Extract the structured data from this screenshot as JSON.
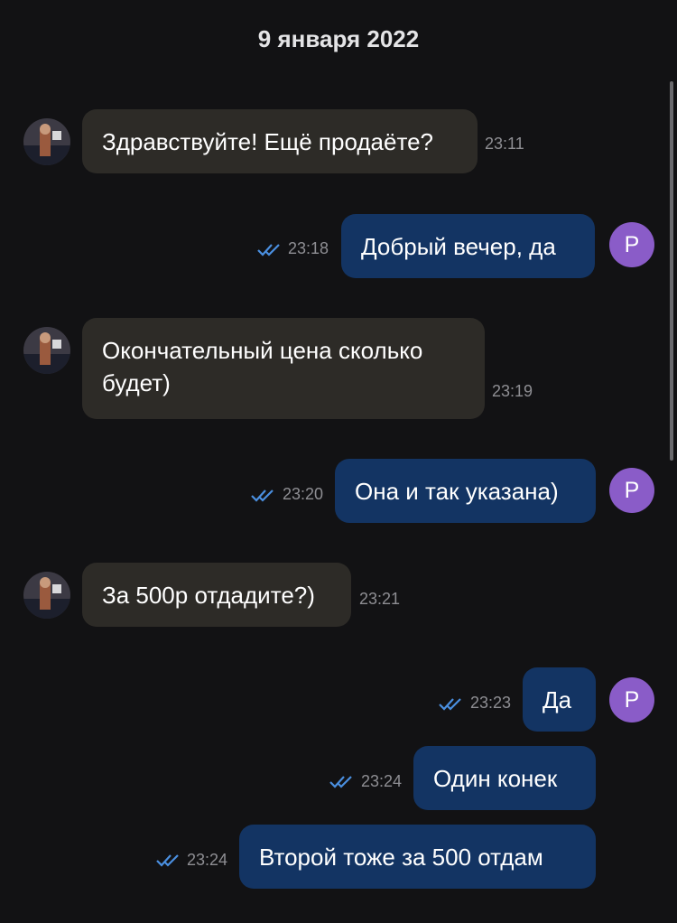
{
  "chat": {
    "date_header": "9 января 2022",
    "my_avatar_letter": "P",
    "messages": [
      {
        "dir": "in",
        "text": "Здравствуйте! Ещё продаёте?",
        "time": "23:11"
      },
      {
        "dir": "out",
        "text": "Добрый вечер, да",
        "time": "23:18",
        "read": true
      },
      {
        "dir": "in",
        "text": "Окончательный цена сколько будет)",
        "time": "23:19"
      },
      {
        "dir": "out",
        "text": "Она и так указана)",
        "time": "23:20",
        "read": true
      },
      {
        "dir": "in",
        "text": "За 500р отдадите?)",
        "time": "23:21"
      },
      {
        "dir": "out",
        "text": "Да",
        "time": "23:23",
        "read": true
      },
      {
        "dir": "out",
        "text": "Один конек",
        "time": "23:24",
        "read": true
      },
      {
        "dir": "out",
        "text": "Второй тоже за 500 отдам",
        "time": "23:24",
        "read": true
      }
    ]
  },
  "colors": {
    "background": "#121214",
    "incoming_bubble": "#2d2b27",
    "outgoing_bubble": "#133463",
    "read_ticks": "#4a8fe0",
    "my_avatar": "#8a5cc8"
  },
  "icons": {
    "read": "double-check-icon"
  }
}
